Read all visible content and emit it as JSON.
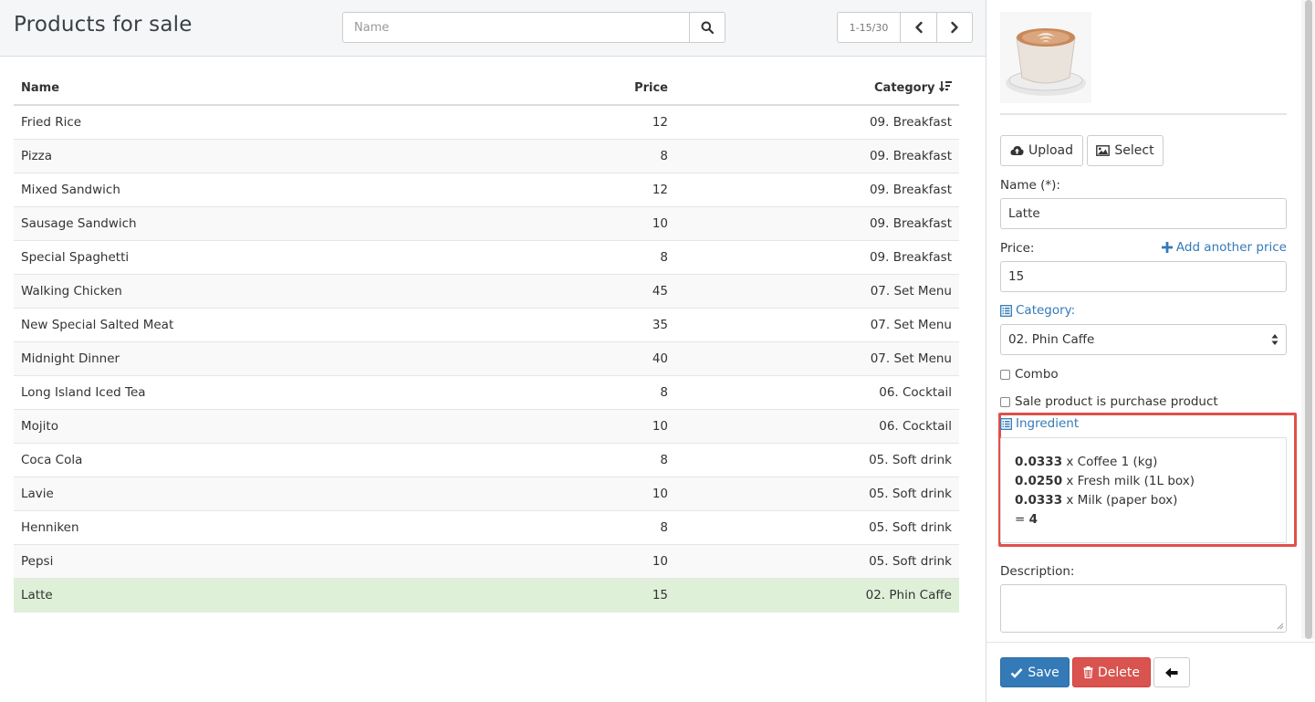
{
  "header": {
    "title": "Products for sale",
    "search_placeholder": "Name",
    "pager_info": "1-15/30"
  },
  "table": {
    "columns": [
      "Name",
      "Price",
      "Category"
    ],
    "rows": [
      {
        "name": "Fried Rice",
        "price": "12",
        "category": "09. Breakfast"
      },
      {
        "name": "Pizza",
        "price": "8",
        "category": "09. Breakfast"
      },
      {
        "name": "Mixed Sandwich",
        "price": "12",
        "category": "09. Breakfast"
      },
      {
        "name": "Sausage Sandwich",
        "price": "10",
        "category": "09. Breakfast"
      },
      {
        "name": "Special Spaghetti",
        "price": "8",
        "category": "09. Breakfast"
      },
      {
        "name": "Walking Chicken",
        "price": "45",
        "category": "07. Set Menu"
      },
      {
        "name": "New Special Salted Meat",
        "price": "35",
        "category": "07. Set Menu"
      },
      {
        "name": "Midnight Dinner",
        "price": "40",
        "category": "07. Set Menu"
      },
      {
        "name": "Long Island Iced Tea",
        "price": "8",
        "category": "06. Cocktail"
      },
      {
        "name": "Mojito",
        "price": "10",
        "category": "06. Cocktail"
      },
      {
        "name": "Coca Cola",
        "price": "8",
        "category": "05. Soft drink"
      },
      {
        "name": "Lavie",
        "price": "10",
        "category": "05. Soft drink"
      },
      {
        "name": "Henniken",
        "price": "8",
        "category": "05. Soft drink"
      },
      {
        "name": "Pepsi",
        "price": "10",
        "category": "05. Soft drink"
      },
      {
        "name": "Latte",
        "price": "15",
        "category": "02. Phin Caffe"
      }
    ],
    "selected_index": 14
  },
  "form": {
    "upload_label": "Upload",
    "select_label": "Select",
    "name_label": "Name (*):",
    "name_value": "Latte",
    "price_label": "Price:",
    "add_price_label": "Add another price",
    "price_value": "15",
    "category_label": "Category:",
    "category_value": "02. Phin Caffe",
    "combo_label": "Combo",
    "purchase_label": "Sale product is purchase product",
    "ingredient_label": "Ingredient",
    "ingredients": [
      {
        "qty": "0.0333",
        "text": " x Coffee 1 (kg)"
      },
      {
        "qty": "0.0250",
        "text": " x Fresh milk (1L box)"
      },
      {
        "qty": "0.0333",
        "text": " x Milk (paper box)"
      }
    ],
    "total_prefix": "= ",
    "total_value": "4",
    "description_label": "Description:",
    "save_label": "Save",
    "delete_label": "Delete"
  },
  "colors": {
    "accent": "#337ab7",
    "danger": "#d9534f",
    "selected_row": "#dff0d8",
    "highlight_border": "#e0504a"
  },
  "icons": [
    "search-icon",
    "chevron-left-icon",
    "chevron-right-icon",
    "sort-icon",
    "cloud-upload-icon",
    "image-icon",
    "plus-icon",
    "list-icon",
    "check-icon",
    "trash-icon",
    "arrow-left-icon"
  ]
}
